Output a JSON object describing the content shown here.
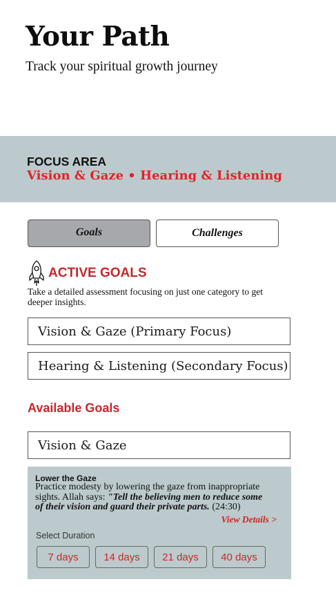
{
  "header": {
    "title": "Your Path",
    "subtitle": "Track your spiritual growth journey"
  },
  "focus": {
    "label": "FOCUS AREA",
    "value": "Vision & Gaze • Hearing & Listening"
  },
  "tabs": [
    {
      "label": "Goals",
      "active": true
    },
    {
      "label": "Challenges",
      "active": false
    }
  ],
  "active_goals": {
    "icon": "rocket-icon",
    "heading": "ACTIVE GOALS",
    "description": "Take a detailed assessment focusing on just one category to get deeper insights.",
    "items": [
      "Vision & Gaze (Primary Focus)",
      "Hearing & Listening (Secondary Focus)"
    ]
  },
  "available_goals": {
    "heading": "Available Goals",
    "selected_category": "Vision & Gaze",
    "card": {
      "title": "Lower the Gaze",
      "body_text": "Practice modesty by lowering the gaze from inappropriate sights. Allah says: ",
      "quote": "\"Tell the believing men to reduce some of their vision and guard their private parts.",
      "citation": " (24:30)",
      "view_details": "View Details >",
      "duration_label": "Select Duration",
      "durations": [
        "7 days",
        "14 days",
        "21 days",
        "40 days"
      ]
    }
  },
  "colors": {
    "accent_red": "#c8262b",
    "band_bg": "#bccacd",
    "tab_active_bg": "#a7a8ab"
  }
}
